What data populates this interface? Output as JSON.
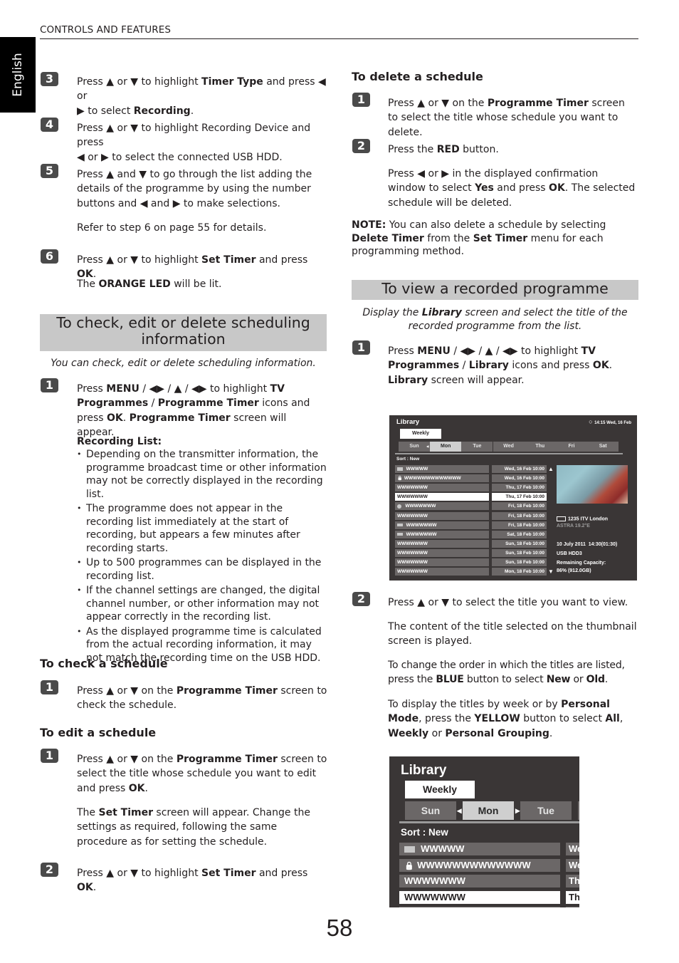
{
  "header": {
    "section": "CONTROLS AND FEATURES",
    "language_tab": "English"
  },
  "left": {
    "steps_top": [
      {
        "num": "3",
        "html": "Press ▲ or ▼ to highlight <b>Timer Type</b> and press ◀ or<br>▶ to select <b>Recording</b>."
      },
      {
        "num": "4",
        "html": "Press ▲ or ▼ to highlight Recording Device and press<br>◀ or ▶ to select the connected USB HDD."
      },
      {
        "num": "5",
        "html": "Press ▲ and ▼ to go through the list adding the details of the programme by using the number buttons and ◀ and ▶ to make selections."
      },
      {
        "num": "5b",
        "html": "Refer to step 6 on page 55 for details."
      },
      {
        "num": "6",
        "html": "Press ▲ or ▼ to highlight <b>Set Timer</b> and press <b>OK</b>."
      },
      {
        "num": "6b",
        "html": "The <b>ORANGE LED</b> will be lit."
      }
    ],
    "section_title": "To check, edit or delete scheduling information",
    "section_intro": "You can check, edit or delete scheduling information.",
    "step1_html": "Press <b>MENU</b> / ◀▶ / ▲ / ◀▶ to highlight <b>TV Programmes</b> / <b>Programme Timer</b> icons and press <b>OK</b>. <b>Programme Timer</b> screen will appear.",
    "recording_list_title": "Recording List:",
    "recording_list": [
      "Depending on the transmitter information, the programme broadcast time or other information may not be correctly displayed in the recording list.",
      "The programme does not appear in the recording list immediately at the start of recording, but appears a few minutes after recording starts.",
      "Up to 500 programmes can be displayed in the recording list.",
      "If the channel settings are changed, the digital channel number, or other information may not appear correctly in the recording list.",
      "As the displayed programme time is calculated from the actual recording information, it may not match the recording time on the USB HDD."
    ],
    "check_title": "To check a schedule",
    "check_step1_html": "Press ▲ or ▼ on the <b>Programme Timer</b> screen to check the schedule.",
    "edit_title": "To edit a schedule",
    "edit_step1_html": "Press ▲ or ▼ on the <b>Programme Timer</b> screen to select the title whose schedule you want to edit and press <b>OK</b>.",
    "edit_step1_note_html": "The <b>Set Timer</b> screen will appear. Change the settings as required, following the same procedure as for setting the schedule.",
    "edit_step2_html": "Press ▲ or ▼ to highlight <b>Set Timer</b> and press <b>OK</b>."
  },
  "right": {
    "delete_title": "To delete a schedule",
    "delete_step1_html": "Press ▲ or ▼ on the <b>Programme Timer</b> screen to select the title whose schedule you want to delete.",
    "delete_step2_html": "Press the <b>RED</b> button.",
    "delete_step2_note_html": "Press ◀ or ▶ in the displayed confirmation window to select <b>Yes</b> and press <b>OK</b>. The selected schedule will be deleted.",
    "note_html": "<b>NOTE:</b> You can also delete a schedule by selecting <b>Delete Timer</b> from the <b>Set Timer</b> menu for each programming method.",
    "view_title": "To view a recorded programme",
    "view_intro_html": "Display the <b>Library</b> screen and select the title of the recorded programme from the list.",
    "view_step1_html": "Press <b>MENU</b> / ◀▶ / ▲ / ◀▶ to highlight <b>TV Programmes</b> / <b>Library</b> icons and press <b>OK</b>. <b>Library</b> screen will appear.",
    "view_step2_html": "Press ▲ or ▼ to select the title you want to view.",
    "view_step2_p1": "The content of the title selected on the thumbnail screen is played.",
    "view_step2_p2_html": "To change the order in which the titles are listed, press the <b>BLUE</b> button to select <b>New</b> or <b>Old</b>.",
    "view_step2_p3_html": "To display the titles by week or by <b>Personal Mode</b>, press the <b>YELLOW</b> button to select <b>All</b>, <b>Weekly</b> or <b>Personal Grouping</b>."
  },
  "library_screen": {
    "title": "Library",
    "clock": "14:15 Wed, 16 Feb",
    "mode": "Weekly",
    "days": [
      "Sun",
      "Mon",
      "Tue",
      "Wed",
      "Thu",
      "Fri",
      "Sat"
    ],
    "selected_day": "Mon",
    "sort_label": "Sort : New",
    "rows": [
      {
        "icon": "rect",
        "name": "WWWWW",
        "date": "Wed, 16 Feb 10:00"
      },
      {
        "icon": "lock",
        "name": "WWWWWWWWWWWWW",
        "date": "Wed, 16 Feb 10:00"
      },
      {
        "icon": "",
        "name": "WWWWWWW",
        "date": "Thu, 17 Feb 10:00"
      },
      {
        "icon": "",
        "name": "WWWWWWW",
        "date": "Thu, 17 Feb 10:00",
        "selected": true
      },
      {
        "icon": "dot",
        "name": "WWWWWWW",
        "date": "Fri, 18 Feb 10:00"
      },
      {
        "icon": "",
        "name": "WWWWWWW",
        "date": "Fri, 18 Feb 10:00"
      },
      {
        "icon": "rect",
        "name": "WWWWWWW",
        "date": "Fri, 18 Feb 10:00"
      },
      {
        "icon": "rect",
        "name": "WWWWWWW",
        "date": "Sat, 18 Feb 10:00"
      },
      {
        "icon": "",
        "name": "WWWWWWW",
        "date": "Sun, 18 Feb 10:00"
      },
      {
        "icon": "",
        "name": "WWWWWWW",
        "date": "Sun, 18 Feb 10:00"
      },
      {
        "icon": "",
        "name": "WWWWWWW",
        "date": "Sun, 18 Feb 10:00"
      },
      {
        "icon": "",
        "name": "WWWWWWW",
        "date": "Mon, 18 Feb 10:00"
      }
    ],
    "channel": "1235 ITV London",
    "satellite": "ASTRA 19.2°E",
    "rec_datetime": "10 July 2011  14:30(01:30)",
    "device": "USB HDD3",
    "capacity_label": "Remaining Capacity:",
    "capacity_value": "86% (912.0GB)"
  },
  "page_number": "58"
}
